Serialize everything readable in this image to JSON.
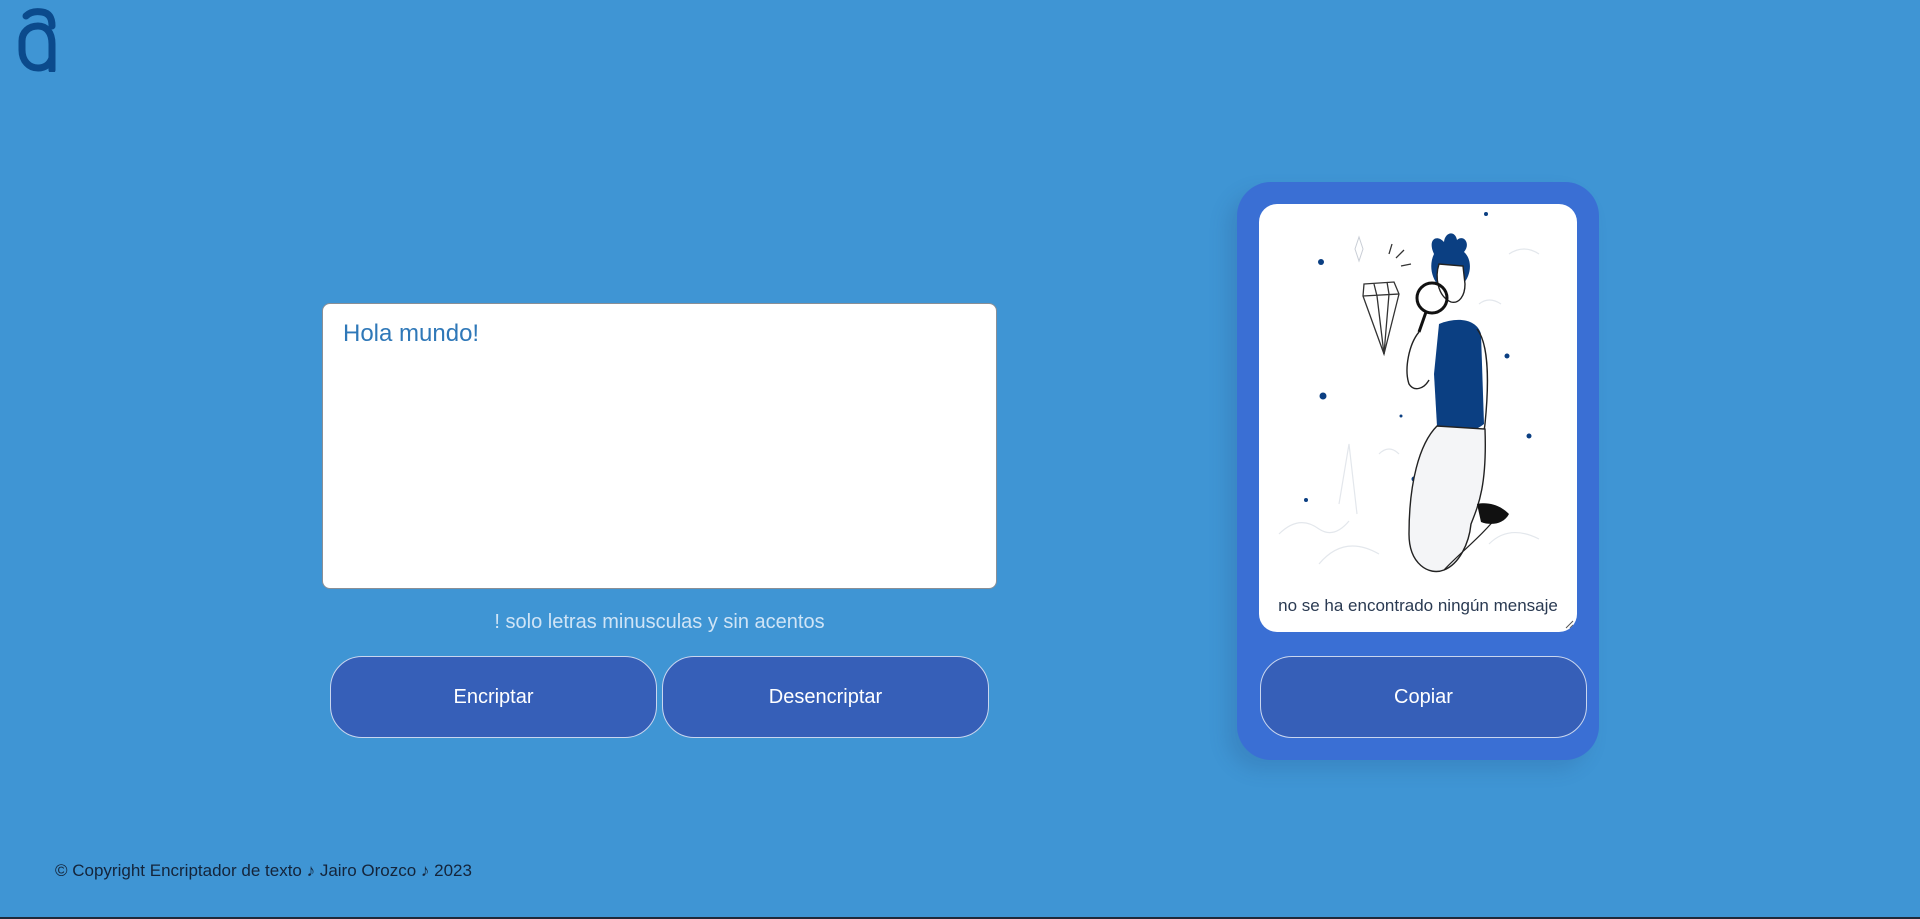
{
  "header": {
    "logo_icon": "alura-a-logo-icon"
  },
  "input": {
    "value": "Hola mundo!"
  },
  "hint": {
    "text": "! solo letras minusculas y sin acentos"
  },
  "buttons": {
    "encrypt_label": "Encriptar",
    "decrypt_label": "Desencriptar",
    "copy_label": "Copiar"
  },
  "output": {
    "empty_message": "no se ha encontrado ningún mensaje",
    "illustration_icon": "person-magnifying-glass-icon"
  },
  "footer": {
    "text": "© Copyright Encriptador de texto ♪ Jairo Orozco ♪ 2023"
  },
  "colors": {
    "background": "#3f95d4",
    "button": "#365fb8",
    "panel": "#3a6fd4",
    "logo": "#0b4a8c"
  }
}
